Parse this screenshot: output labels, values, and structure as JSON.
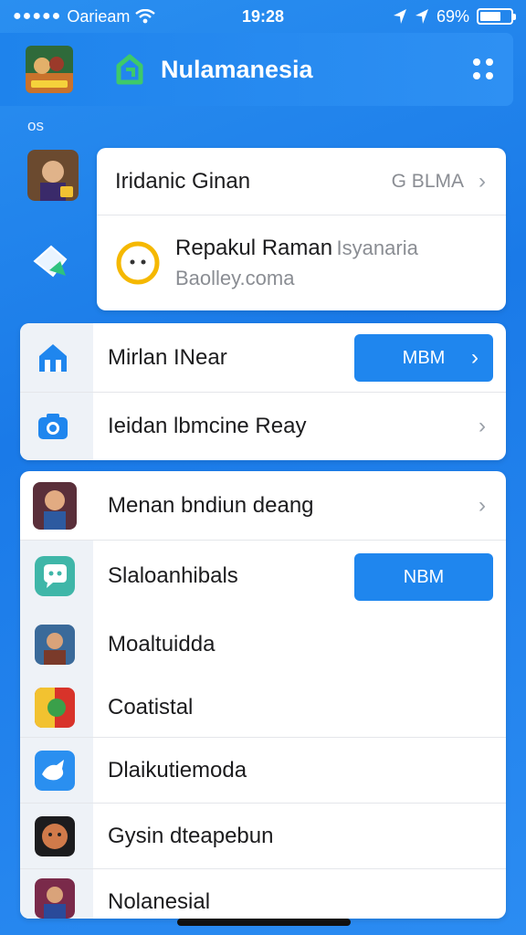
{
  "status": {
    "carrier": "Oarieam",
    "time": "19:28",
    "battery_pct": "69%",
    "battery_level": 0.69
  },
  "header": {
    "title": "Nulamanesia"
  },
  "section_label": "os",
  "popup": {
    "row1_label": "Iridanic Ginan",
    "row1_value": "G BLMA",
    "row2_title": "Repakul Raman",
    "row2_title_extra": "Isyanaria",
    "row2_sub": "Baolley.coma"
  },
  "group1": {
    "row1_label": "Mirlan INear",
    "row1_button": "MBM",
    "row2_label": "Ieidan lbmcine Reay"
  },
  "group2": {
    "rows": [
      {
        "label": "Menan bndiun deang"
      },
      {
        "label": "Slaloanhibals",
        "button": "NBM"
      },
      {
        "label": "Moaltuidda"
      },
      {
        "label": "Coatistal"
      },
      {
        "label": "Dlaikutiemoda"
      },
      {
        "label": "Gysin dteapebun"
      },
      {
        "label": "Nolanesial"
      }
    ]
  },
  "colors": {
    "background": "#1a7ae8",
    "accent": "#1f86ee",
    "brand_green": "#3ec96a"
  },
  "icons": [
    "signal-dots-icon",
    "wifi-icon",
    "location-icon",
    "battery-icon",
    "grid-menu-icon",
    "home-icon",
    "camera-icon",
    "chevron-right-icon",
    "chat-icon",
    "smile-icon"
  ]
}
